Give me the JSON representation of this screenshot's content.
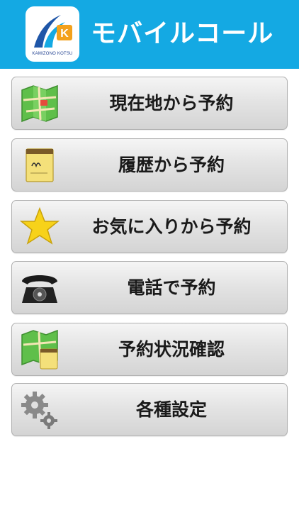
{
  "header": {
    "title": "モバイルコール",
    "logo_text": "KAMIZONO KOTSU",
    "logo_letter": "K",
    "bg_color": "#14a9e3"
  },
  "menu": [
    {
      "label": "現在地から予約",
      "icon": "map-icon"
    },
    {
      "label": "履歴から予約",
      "icon": "notepad-icon"
    },
    {
      "label": "お気に入りから予約",
      "icon": "star-icon"
    },
    {
      "label": "電話で予約",
      "icon": "telephone-icon"
    },
    {
      "label": "予約状況確認",
      "icon": "map-with-note-icon"
    },
    {
      "label": "各種設定",
      "icon": "gear-icon"
    }
  ]
}
